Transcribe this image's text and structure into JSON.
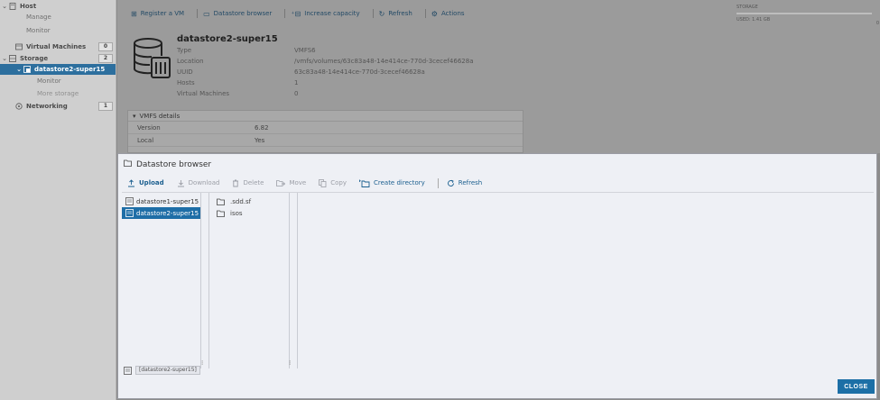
{
  "nav": {
    "items": [
      {
        "label": "Host",
        "icon": "host-icon"
      },
      {
        "label": "Manage"
      },
      {
        "label": "Monitor"
      },
      {
        "label": "Virtual Machines",
        "badge": "0",
        "icon": "vm-icon"
      },
      {
        "label": "Storage",
        "badge": "2",
        "icon": "storage-icon"
      },
      {
        "label": "datastore2-super15",
        "icon": "datastore-icon"
      },
      {
        "label": "Monitor"
      },
      {
        "label": "More storage"
      },
      {
        "label": "Networking",
        "badge": "1",
        "icon": "network-icon"
      }
    ]
  },
  "toolbar": {
    "register_vm": "Register a VM",
    "datastore_browser": "Datastore browser",
    "increase_capacity": "Increase capacity",
    "refresh": "Refresh",
    "actions": "Actions"
  },
  "datastore": {
    "title": "datastore2-super15",
    "props": [
      {
        "key": "Type",
        "value": "VMFS6"
      },
      {
        "key": "Location",
        "value": "/vmfs/volumes/63c83a48-14e414ce-770d-3cecef46628a"
      },
      {
        "key": "UUID",
        "value": "63c83a48-14e414ce-770d-3cecef46628a"
      },
      {
        "key": "Hosts",
        "value": "1"
      },
      {
        "key": "Virtual Machines",
        "value": "0"
      }
    ]
  },
  "vmfs": {
    "header": "VMFS details",
    "rows": [
      {
        "key": "Version",
        "value": "6.82"
      },
      {
        "key": "Local",
        "value": "Yes"
      }
    ]
  },
  "storage_panel": {
    "header": "STORAGE",
    "used": "USED: 1.41 GB",
    "free": "0"
  },
  "modal": {
    "title": "Datastore browser",
    "toolbar": {
      "upload": "Upload",
      "download": "Download",
      "delete": "Delete",
      "move": "Move",
      "copy": "Copy",
      "create_directory": "Create directory",
      "refresh": "Refresh"
    },
    "datastores": [
      "datastore1-super15",
      "datastore2-super15"
    ],
    "selected_datastore": 1,
    "folders": [
      ".sdd.sf",
      "isos"
    ],
    "path": "[datastore2-super15]",
    "close_label": "CLOSE"
  },
  "colors": {
    "accent": "#1e6ea7",
    "close_button": "#1c6fa6"
  }
}
